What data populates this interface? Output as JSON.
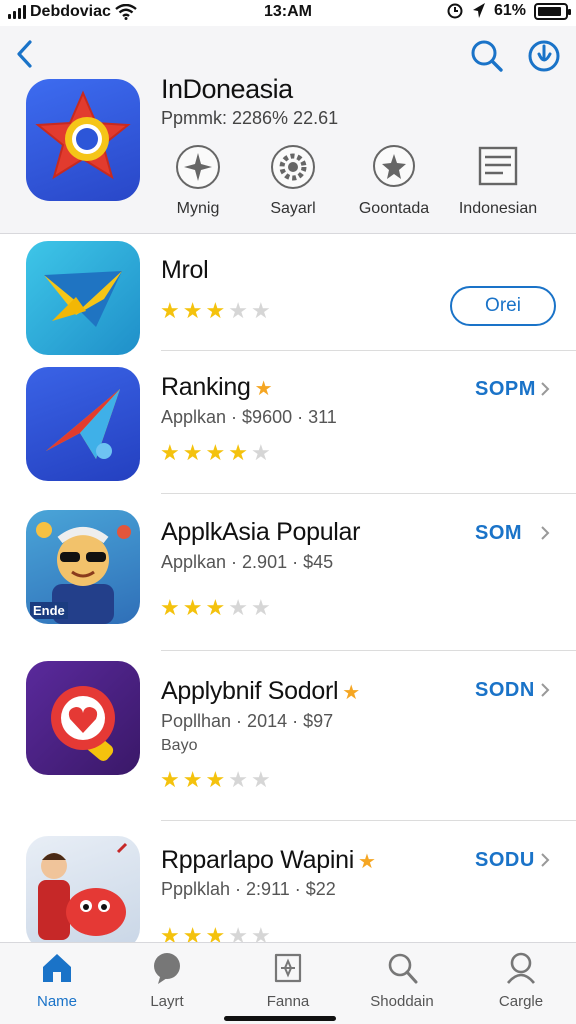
{
  "status": {
    "carrier": "Debdoviac",
    "time": "13:AM",
    "battery": "61%",
    "battery_level": 0.9
  },
  "header": {
    "title": "InDoneasia",
    "subtitle": "Ppmmk:  2286% 22.61",
    "categories": [
      {
        "label": "Mynig",
        "icon": "sparkle-icon"
      },
      {
        "label": "Sayarl",
        "icon": "gear-icon"
      },
      {
        "label": "Goontada",
        "icon": "chat-star-icon"
      },
      {
        "label": "Indonesian",
        "icon": "document-icon"
      }
    ]
  },
  "apps": [
    {
      "name": "Mrol",
      "meta": "",
      "extra": "",
      "rating": 3,
      "action": "Orei",
      "action_type": "open-button",
      "name_badge": ""
    },
    {
      "name": "Ranking",
      "meta": "Applkan · $9600 · 311",
      "extra": "",
      "rating": 4,
      "action": "SOPM",
      "action_type": "price",
      "name_badge": "★"
    },
    {
      "name": "ApplkAsia Popular",
      "meta": "Applkan · 2.901 · $45",
      "extra": "",
      "rating": 3,
      "action": "SOM",
      "action_type": "price",
      "name_badge": ""
    },
    {
      "name": "Applybnif Sodorl",
      "meta": "Popllhan · 2014 · $97",
      "extra": "Bayo",
      "rating": 3,
      "action": "SODN",
      "action_type": "price",
      "name_badge": "★"
    },
    {
      "name": "Rpparlapo Wapini",
      "meta": "Ppplklah · 2:911 · $22",
      "extra": "",
      "rating": 3,
      "action": "SODU",
      "action_type": "price",
      "name_badge": "★"
    }
  ],
  "app_badge_label": "Ende",
  "tabs": [
    {
      "label": "Name",
      "icon": "home-icon",
      "active": true
    },
    {
      "label": "Layrt",
      "icon": "chat-bubble-icon",
      "active": false
    },
    {
      "label": "Fanna",
      "icon": "store-icon",
      "active": false
    },
    {
      "label": "Shoddain",
      "icon": "search-icon",
      "active": false
    },
    {
      "label": "Cargle",
      "icon": "profile-icon",
      "active": false
    }
  ],
  "colors": {
    "accent": "#1a73c8",
    "star": "#f4c20d",
    "star_empty": "#d6d6d6",
    "header_bg": "#f5f5f7"
  }
}
